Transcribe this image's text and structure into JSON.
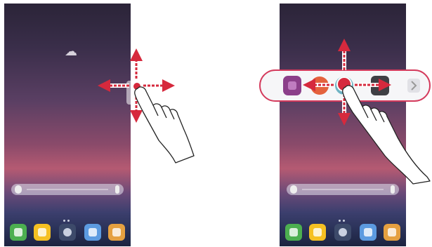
{
  "screens": [
    {
      "id": "left",
      "gesture": "drag-floating-bar-handle",
      "dock_apps": [
        "phone-icon",
        "message-icon",
        "camera-icon",
        "gallery-icon",
        "chrome-icon"
      ]
    },
    {
      "id": "right",
      "gesture": "floating-bar-expanded",
      "bar_shortcuts": [
        "music-icon",
        "orange-app-icon",
        "active-dot-icon",
        "blue-app-icon",
        "dark-app-icon",
        "collapse-arrow-icon"
      ],
      "dock_apps": [
        "phone-icon",
        "message-icon",
        "camera-icon",
        "gallery-icon",
        "chrome-icon"
      ]
    }
  ],
  "colors": {
    "accent_arrow": "#d6293d",
    "pill_outline": "#d43a5c",
    "pill_fill": "#f6f6f8"
  }
}
